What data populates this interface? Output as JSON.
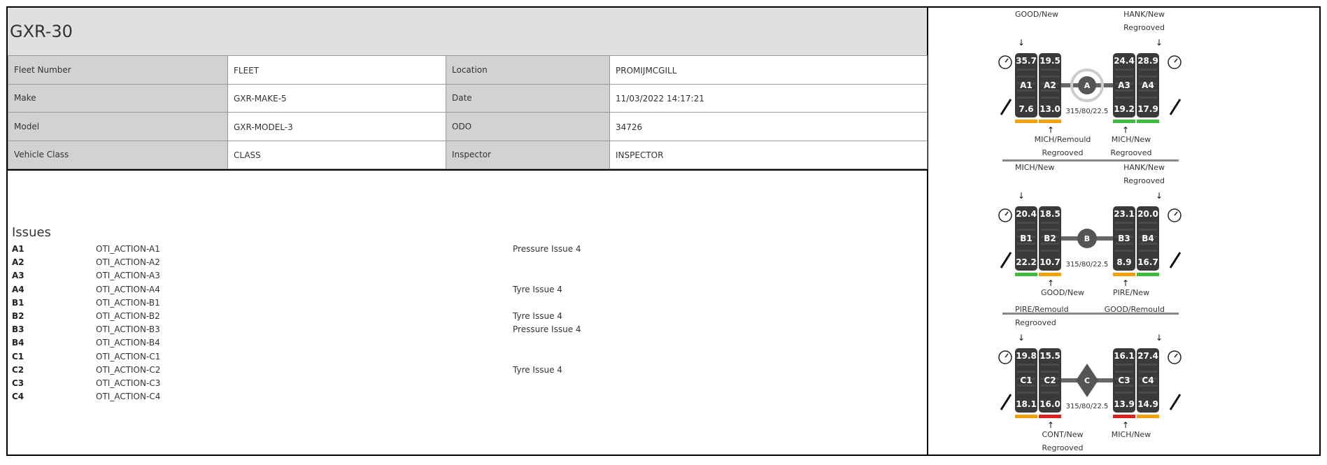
{
  "vehicle": {
    "title": "GXR-30"
  },
  "info": {
    "fleet_label": "Fleet Number",
    "fleet_value": "FLEET",
    "location_label": "Location",
    "location_value": "PROMIJMCGILL",
    "make_label": "Make",
    "make_value": "GXR-MAKE-5",
    "date_label": "Date",
    "date_value": "11/03/2022 14:17:21",
    "model_label": "Model",
    "model_value": "GXR-MODEL-3",
    "odo_label": "ODO",
    "odo_value": "34726",
    "class_label": "Vehicle Class",
    "class_value": "CLASS",
    "inspector_label": "Inspector",
    "inspector_value": "INSPECTOR"
  },
  "issues": {
    "title": "Issues",
    "rows": [
      {
        "tyre": "A1",
        "action": "OTI_ACTION-A1",
        "issue": "Pressure Issue 4"
      },
      {
        "tyre": "A2",
        "action": "OTI_ACTION-A2",
        "issue": ""
      },
      {
        "tyre": "A3",
        "action": "OTI_ACTION-A3",
        "issue": ""
      },
      {
        "tyre": "A4",
        "action": "OTI_ACTION-A4",
        "issue": "Tyre Issue 4"
      },
      {
        "tyre": "B1",
        "action": "OTI_ACTION-B1",
        "issue": ""
      },
      {
        "tyre": "B2",
        "action": "OTI_ACTION-B2",
        "issue": "Tyre Issue 4"
      },
      {
        "tyre": "B3",
        "action": "OTI_ACTION-B3",
        "issue": "Pressure Issue 4"
      },
      {
        "tyre": "B4",
        "action": "OTI_ACTION-B4",
        "issue": ""
      },
      {
        "tyre": "C1",
        "action": "OTI_ACTION-C1",
        "issue": ""
      },
      {
        "tyre": "C2",
        "action": "OTI_ACTION-C2",
        "issue": "Tyre Issue 4"
      },
      {
        "tyre": "C3",
        "action": "OTI_ACTION-C3",
        "issue": ""
      },
      {
        "tyre": "C4",
        "action": "OTI_ACTION-C4",
        "issue": ""
      }
    ]
  },
  "axles": [
    {
      "label": "A",
      "size": "315/80/22.5",
      "hub": "steering-wheel",
      "top_left": [
        "GOOD/New"
      ],
      "top_right": [
        "HANK/New",
        "Regrooved"
      ],
      "bottom_left": [
        "MICH/Remould",
        "Regrooved"
      ],
      "bottom_right": [
        "MICH/New",
        "Regrooved"
      ],
      "tyres": [
        {
          "id": "A1",
          "pressure": "35.7",
          "tread": "7.6",
          "status": "orange"
        },
        {
          "id": "A2",
          "pressure": "19.5",
          "tread": "13.0",
          "status": "orange"
        },
        {
          "id": "A3",
          "pressure": "24.4",
          "tread": "19.2",
          "status": "green"
        },
        {
          "id": "A4",
          "pressure": "28.9",
          "tread": "17.9",
          "status": "green"
        }
      ]
    },
    {
      "label": "B",
      "size": "315/80/22.5",
      "hub": "circle",
      "top_left": [
        "MICH/New"
      ],
      "top_right": [
        "HANK/New",
        "Regrooved"
      ],
      "bottom_left": [
        "GOOD/New"
      ],
      "bottom_right": [
        "PIRE/New"
      ],
      "tyres": [
        {
          "id": "B1",
          "pressure": "20.4",
          "tread": "22.2",
          "status": "green"
        },
        {
          "id": "B2",
          "pressure": "18.5",
          "tread": "10.7",
          "status": "orange"
        },
        {
          "id": "B3",
          "pressure": "23.1",
          "tread": "8.9",
          "status": "orange"
        },
        {
          "id": "B4",
          "pressure": "20.0",
          "tread": "16.7",
          "status": "green"
        }
      ]
    },
    {
      "label": "C",
      "size": "315/80/22.5",
      "hub": "diamond",
      "top_left": [
        "PIRE/Remould",
        "Regrooved"
      ],
      "top_right": [
        "GOOD/Remould"
      ],
      "bottom_left": [
        "CONT/New",
        "Regrooved"
      ],
      "bottom_right": [
        "MICH/New"
      ],
      "tyres": [
        {
          "id": "C1",
          "pressure": "19.8",
          "tread": "18.1",
          "status": "orange"
        },
        {
          "id": "C2",
          "pressure": "15.5",
          "tread": "16.0",
          "status": "red"
        },
        {
          "id": "C3",
          "pressure": "16.1",
          "tread": "13.9",
          "status": "red"
        },
        {
          "id": "C4",
          "pressure": "27.4",
          "tread": "14.9",
          "status": "orange"
        }
      ]
    }
  ],
  "colors": {
    "green": "#3dbb3d",
    "orange": "#f5a000",
    "red": "#e02020",
    "tyre": "#3a3a3a",
    "axle": "#666666"
  }
}
